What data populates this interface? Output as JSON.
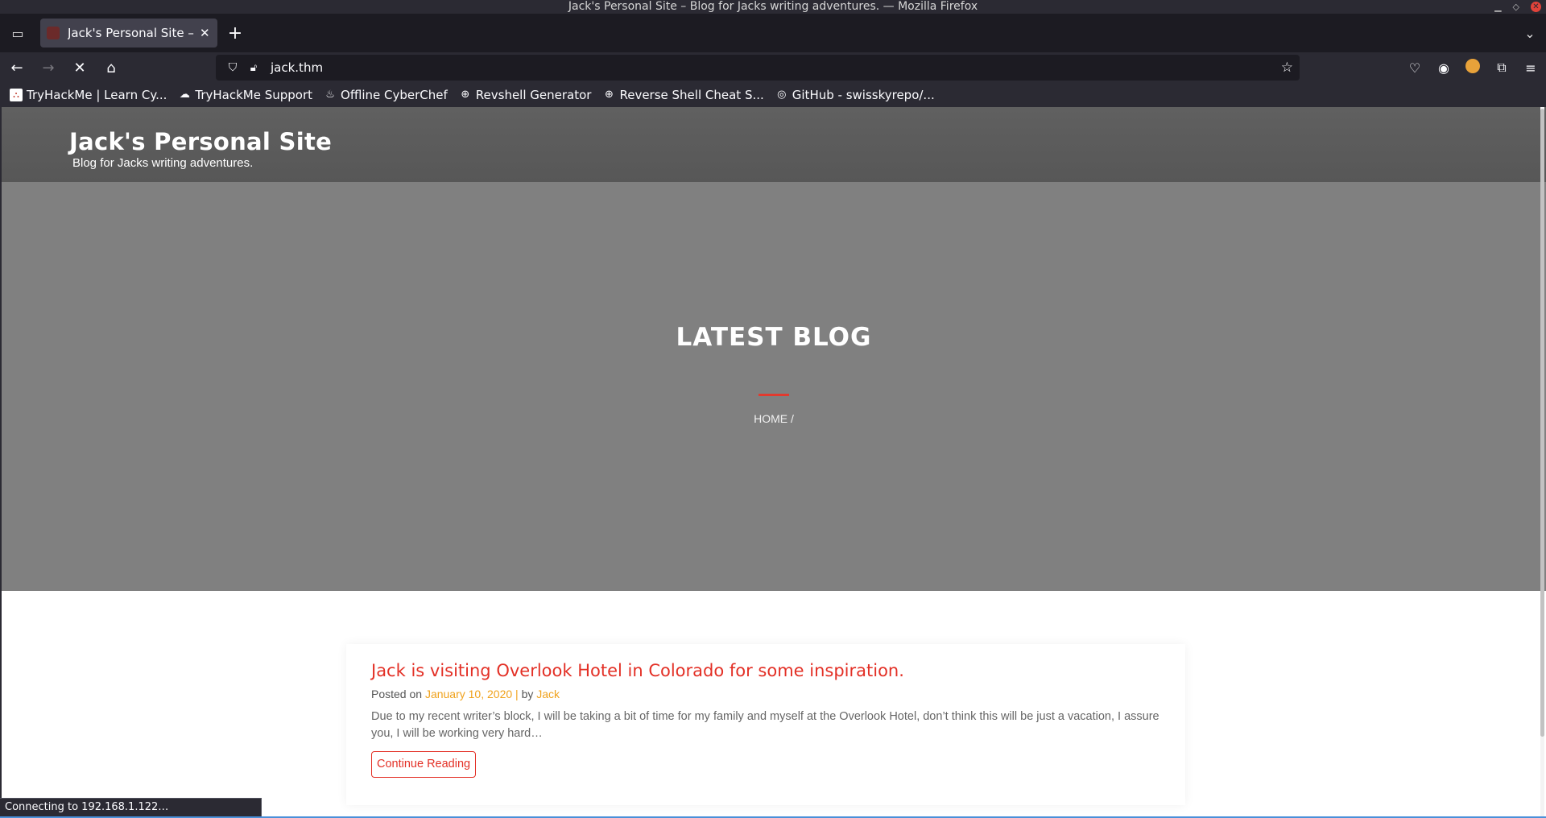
{
  "window": {
    "title": "Jack's Personal Site – Blog for Jacks writing adventures. — Mozilla Firefox"
  },
  "tabs": [
    {
      "title": "Jack's Personal Site – Blo"
    }
  ],
  "urlbar": {
    "url": "jack.thm"
  },
  "bookmarks": [
    {
      "label": "TryHackMe | Learn Cy...",
      "icon": "tryhackme-icon"
    },
    {
      "label": "TryHackMe Support",
      "icon": "cloud-icon"
    },
    {
      "label": "Offline CyberChef",
      "icon": "chef-icon"
    },
    {
      "label": "Revshell Generator",
      "icon": "globe-icon"
    },
    {
      "label": "Reverse Shell Cheat S...",
      "icon": "globe-icon"
    },
    {
      "label": "GitHub - swisskyrepo/...",
      "icon": "github-icon"
    }
  ],
  "site": {
    "title": "Jack's Personal Site",
    "tagline": "Blog for Jacks writing adventures."
  },
  "hero": {
    "title": "LATEST BLOG",
    "breadcrumb": "HOME /"
  },
  "post": {
    "title": "Jack is visiting Overlook Hotel in Colorado for some inspiration.",
    "meta_prefix": "Posted on",
    "date": "January 10, 2020",
    "separator": "|",
    "by": "by",
    "author": "Jack",
    "excerpt": "Due to my recent writer’s block, I will be taking a bit of time for my family and myself at the Overlook Hotel, don’t think this will be just a vacation, I assure you, I will be working very hard…",
    "button": "Continue Reading"
  },
  "status": {
    "text": "Connecting to 192.168.1.122…"
  },
  "colors": {
    "accent_red": "#e33026",
    "meta_orange": "#f0a21c",
    "hero_gray": "#808080",
    "header_gray": "#5b5b5b"
  }
}
